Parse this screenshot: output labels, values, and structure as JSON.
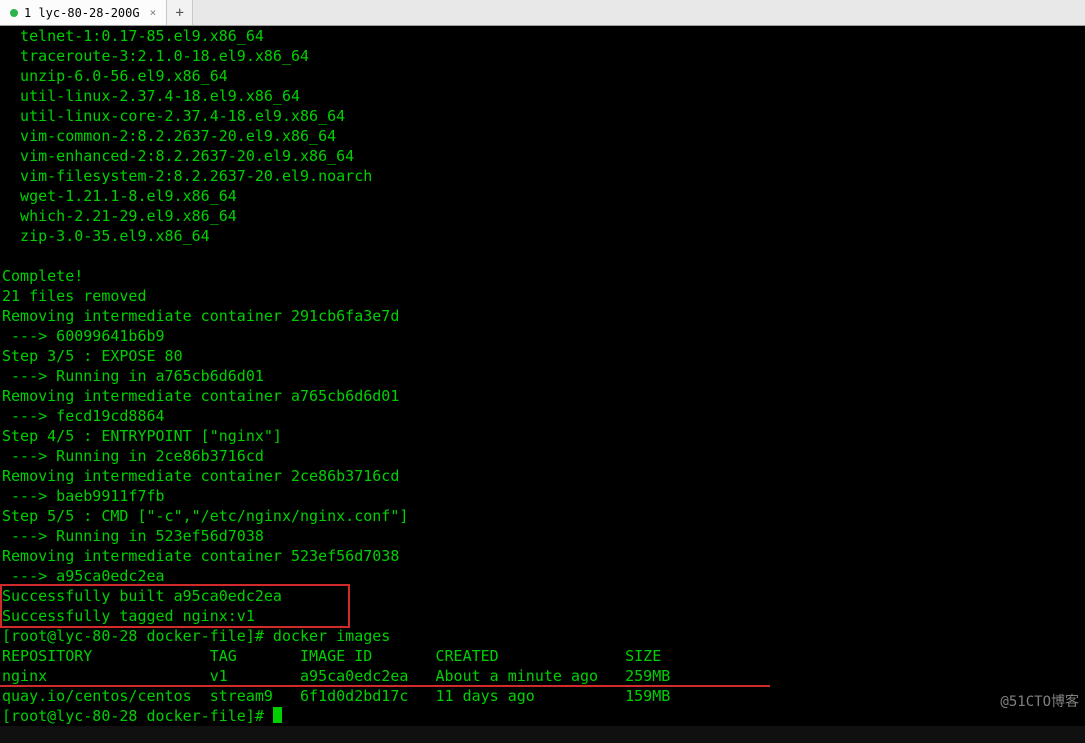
{
  "tabbar": {
    "active_tab_label": "1 lyc-80-28-200G",
    "active_tab_close": "×",
    "new_tab_label": "+"
  },
  "watermark": "@51CTO博客",
  "terminal": {
    "lines": [
      "  telnet-1:0.17-85.el9.x86_64",
      "  traceroute-3:2.1.0-18.el9.x86_64",
      "  unzip-6.0-56.el9.x86_64",
      "  util-linux-2.37.4-18.el9.x86_64",
      "  util-linux-core-2.37.4-18.el9.x86_64",
      "  vim-common-2:8.2.2637-20.el9.x86_64",
      "  vim-enhanced-2:8.2.2637-20.el9.x86_64",
      "  vim-filesystem-2:8.2.2637-20.el9.noarch",
      "  wget-1.21.1-8.el9.x86_64",
      "  which-2.21-29.el9.x86_64",
      "  zip-3.0-35.el9.x86_64",
      "",
      "Complete!",
      "21 files removed",
      "Removing intermediate container 291cb6fa3e7d",
      " ---> 60099641b6b9",
      "Step 3/5 : EXPOSE 80",
      " ---> Running in a765cb6d6d01",
      "Removing intermediate container a765cb6d6d01",
      " ---> fecd19cd8864",
      "Step 4/5 : ENTRYPOINT [\"nginx\"]",
      " ---> Running in 2ce86b3716cd",
      "Removing intermediate container 2ce86b3716cd",
      " ---> baeb9911f7fb",
      "Step 5/5 : CMD [\"-c\",\"/etc/nginx/nginx.conf\"]",
      " ---> Running in 523ef56d7038",
      "Removing intermediate container 523ef56d7038",
      " ---> a95ca0edc2ea",
      "Successfully built a95ca0edc2ea",
      "Successfully tagged nginx:v1",
      "[root@lyc-80-28 docker-file]# docker images",
      "REPOSITORY             TAG       IMAGE ID       CREATED              SIZE",
      "nginx                  v1        a95ca0edc2ea   About a minute ago   259MB",
      "quay.io/centos/centos  stream9   6f1d0d2bd17c   11 days ago          159MB",
      "[root@lyc-80-28 docker-file]# "
    ]
  }
}
